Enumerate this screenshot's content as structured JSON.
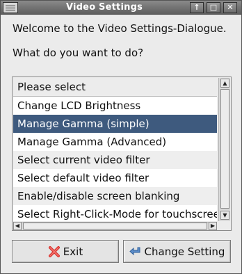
{
  "window": {
    "title": "Video Settings"
  },
  "intro": {
    "welcome": "Welcome to the Video Settings-Dialogue.",
    "question": "What do you want to do?"
  },
  "list": {
    "header": "Please select",
    "items": [
      "Change LCD Brightness",
      "Manage Gamma (simple)",
      "Manage Gamma (Advanced)",
      "Select current video filter",
      "Select default video filter",
      "Enable/disable screen blanking",
      "Select Right-Click-Mode for touchscreen"
    ],
    "selected_index": 1
  },
  "buttons": {
    "exit": "Exit",
    "change": "Change Setting"
  },
  "colors": {
    "selection": "#3e5a7e",
    "exit_icon": "#d9302c",
    "change_icon": "#5b8cc9"
  },
  "icons": {
    "exit": "red-x-icon",
    "change": "back-arrow-icon"
  }
}
